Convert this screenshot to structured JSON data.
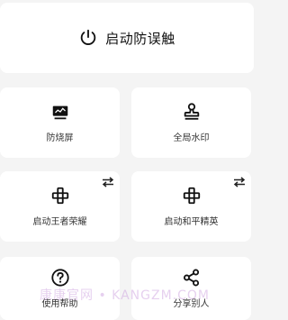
{
  "main_toggle": {
    "label": "启动防误触",
    "icon": "power-icon"
  },
  "tiles": [
    {
      "label": "防烧屏",
      "icon": "monitor-icon"
    },
    {
      "label": "全局水印",
      "icon": "stamp-icon"
    },
    {
      "label": "启动王者荣耀",
      "icon": "gamepad-icon"
    },
    {
      "label": "启动和平精英",
      "icon": "gamepad-icon"
    },
    {
      "label": "使用帮助",
      "icon": "help-icon"
    },
    {
      "label": "分享别人",
      "icon": "share-icon"
    }
  ],
  "watermark": "康康官网 • KANGZM.COM"
}
